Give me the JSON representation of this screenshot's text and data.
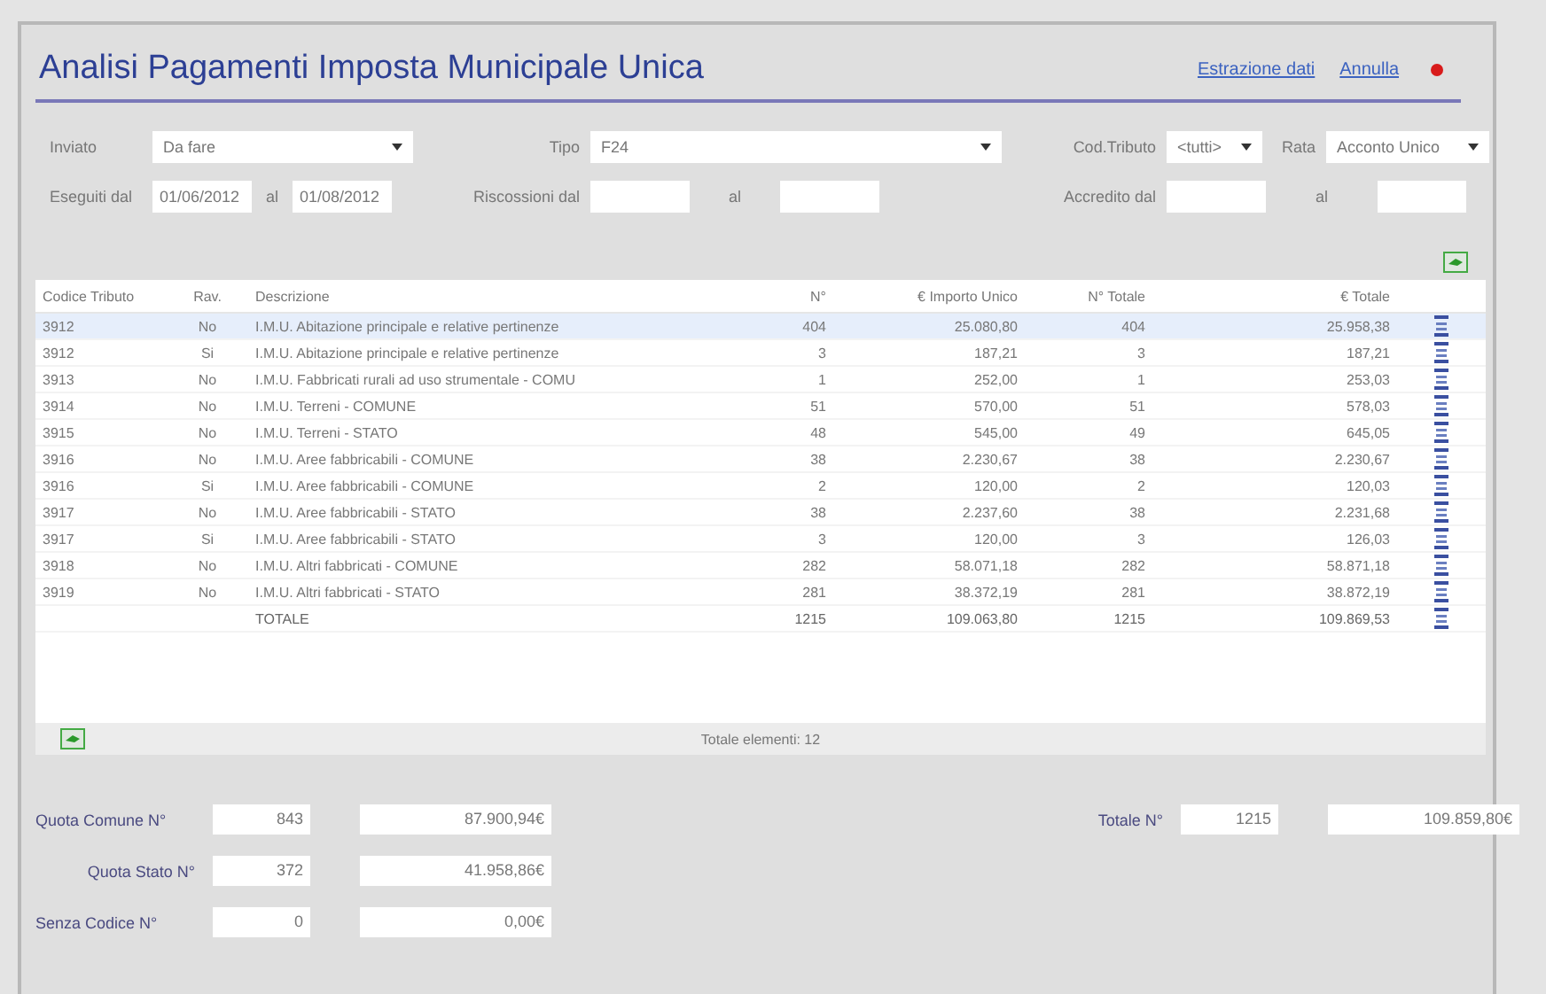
{
  "header": {
    "title": "Analisi Pagamenti Imposta Municipale Unica",
    "links": [
      "Estrazione dati",
      "Annulla"
    ]
  },
  "filters": {
    "inviato": {
      "label": "Inviato",
      "value": "Da fare"
    },
    "tipo": {
      "label": "Tipo",
      "value": "F24"
    },
    "cod_tributo": {
      "label": "Cod.Tributo",
      "value": "<tutti>"
    },
    "rata": {
      "label": "Rata",
      "value": "Acconto Unico"
    },
    "eseguiti": {
      "label": "Eseguiti dal",
      "from": "01/06/2012",
      "to_label": "al",
      "to": "01/08/2012"
    },
    "riscossioni": {
      "label": "Riscossioni dal",
      "to_label": "al"
    },
    "accredito": {
      "label": "Accredito dal",
      "to_label": "al"
    }
  },
  "table": {
    "columns": [
      "Codice Tributo",
      "Rav.",
      "Descrizione",
      "N°",
      "€ Importo Unico",
      "N° Totale",
      "€ Totale"
    ],
    "rows": [
      {
        "cells": [
          "3912",
          "No",
          "I.M.U. Abitazione principale e relative pertinenze",
          "404",
          "25.080,80",
          "404",
          "25.958,38"
        ],
        "selected": true,
        "kind": "data"
      },
      {
        "cells": [
          "3912",
          "Si",
          "I.M.U. Abitazione principale e relative pertinenze",
          "3",
          "187,21",
          "3",
          "187,21"
        ],
        "selected": false,
        "kind": "data"
      },
      {
        "cells": [
          "3913",
          "No",
          "I.M.U. Fabbricati rurali ad uso strumentale - COMU",
          "1",
          "252,00",
          "1",
          "253,03"
        ],
        "selected": false,
        "kind": "data"
      },
      {
        "cells": [
          "3914",
          "No",
          "I.M.U. Terreni - COMUNE",
          "51",
          "570,00",
          "51",
          "578,03"
        ],
        "selected": false,
        "kind": "data"
      },
      {
        "cells": [
          "3915",
          "No",
          "I.M.U. Terreni - STATO",
          "48",
          "545,00",
          "49",
          "645,05"
        ],
        "selected": false,
        "kind": "data"
      },
      {
        "cells": [
          "3916",
          "No",
          "I.M.U. Aree fabbricabili - COMUNE",
          "38",
          "2.230,67",
          "38",
          "2.230,67"
        ],
        "selected": false,
        "kind": "data"
      },
      {
        "cells": [
          "3916",
          "Si",
          "I.M.U. Aree fabbricabili - COMUNE",
          "2",
          "120,00",
          "2",
          "120,03"
        ],
        "selected": false,
        "kind": "data"
      },
      {
        "cells": [
          "3917",
          "No",
          "I.M.U. Aree fabbricabili - STATO",
          "38",
          "2.237,60",
          "38",
          "2.231,68"
        ],
        "selected": false,
        "kind": "data"
      },
      {
        "cells": [
          "3917",
          "Si",
          "I.M.U. Aree fabbricabili - STATO",
          "3",
          "120,00",
          "3",
          "126,03"
        ],
        "selected": false,
        "kind": "data"
      },
      {
        "cells": [
          "3918",
          "No",
          "I.M.U. Altri fabbricati - COMUNE",
          "282",
          "58.071,18",
          "282",
          "58.871,18"
        ],
        "selected": false,
        "kind": "data"
      },
      {
        "cells": [
          "3919",
          "No",
          "I.M.U. Altri fabbricati - STATO",
          "281",
          "38.372,19",
          "281",
          "38.872,19"
        ],
        "selected": false,
        "kind": "data"
      },
      {
        "cells": [
          "",
          "",
          "TOTALE",
          "1215",
          "109.063,80",
          "1215",
          "109.869,53"
        ],
        "selected": false,
        "kind": "total"
      }
    ],
    "footer": "Totale elementi: 12"
  },
  "summary": [
    {
      "label": "Quota Comune N°",
      "count": "843",
      "amount": "87.900,94€"
    },
    {
      "label": "Quota Stato N°",
      "count": "372",
      "amount": "41.958,86€"
    },
    {
      "label": "Senza Codice N°",
      "count": "0",
      "amount": "0,00€"
    }
  ],
  "total": {
    "label": "Totale N°",
    "count": "1215",
    "amount": "109.859,80€"
  }
}
